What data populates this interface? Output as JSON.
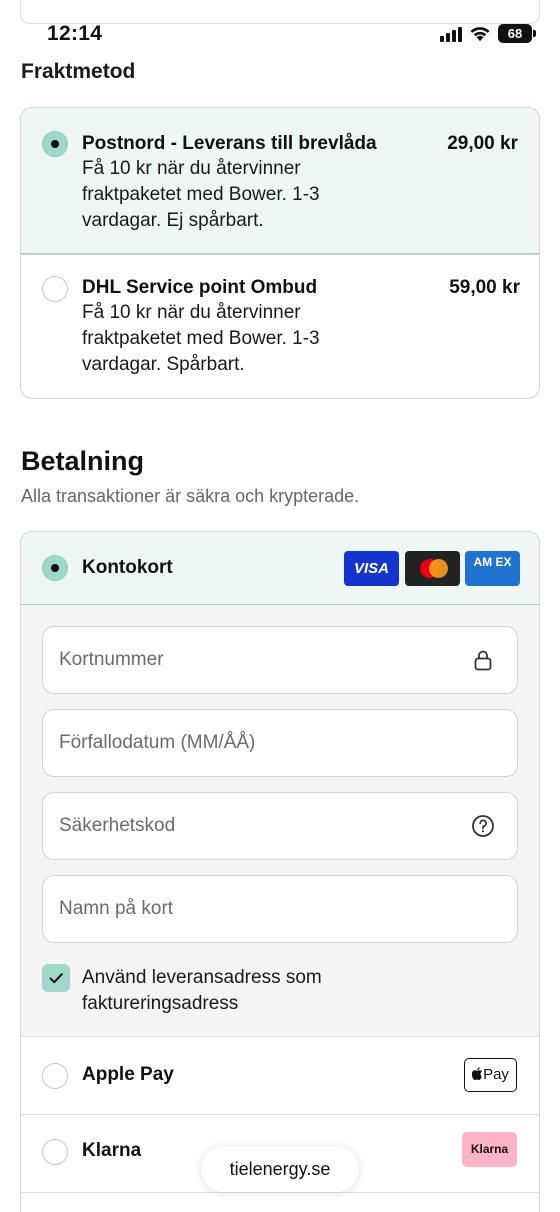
{
  "status_bar": {
    "time": "12:14",
    "battery": "68"
  },
  "shipping": {
    "title": "Fraktmetod",
    "options": [
      {
        "title": "Postnord - Leverans till brevlåda",
        "price": "29,00 kr",
        "description": "Få 10 kr när du återvinner fraktpaketet med Bower. 1-3 vardagar. Ej spårbart.",
        "selected": true
      },
      {
        "title": "DHL Service point Ombud",
        "price": "59,00 kr",
        "description": "Få 10 kr när du återvinner fraktpaketet med Bower. 1-3 vardagar. Spårbart.",
        "selected": false
      }
    ]
  },
  "payment": {
    "title": "Betalning",
    "subtitle": "Alla transaktioner är säkra och krypterade.",
    "card": {
      "label": "Kontokort",
      "logos": [
        "VISA",
        "Mastercard",
        "AMEX"
      ],
      "visa_text": "VISA",
      "amex_text": "AM EX",
      "fields": {
        "number_placeholder": "Kortnummer",
        "expiry_placeholder": "Förfallodatum (MM/ÅÅ)",
        "cvc_placeholder": "Säkerhetskod",
        "name_placeholder": "Namn på kort"
      },
      "billing_checkbox_label": "Använd leveransadress som faktureringsadress",
      "billing_checked": true
    },
    "methods": [
      {
        "label": "Apple Pay",
        "badge": "Pay"
      },
      {
        "label": "Klarna",
        "badge": "Klarna"
      }
    ]
  },
  "browser": {
    "url": "tielenergy.se"
  },
  "colors": {
    "accent": "#9fd8cb",
    "selected_bg": "#eef7f5"
  }
}
